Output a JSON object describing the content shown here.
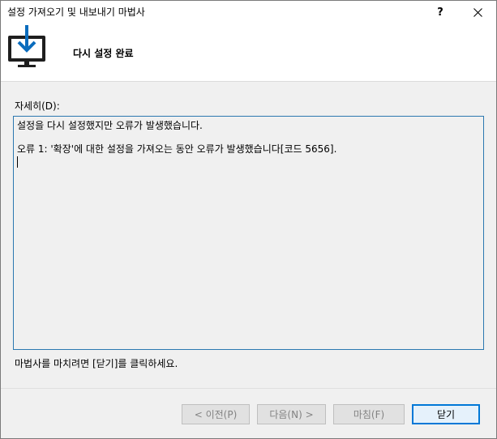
{
  "window": {
    "title": "설정 가져오기 및 내보내기 마법사",
    "help_label": "?",
    "close_label": "✕"
  },
  "header": {
    "title": "다시 설정 완료",
    "icon": "monitor-download-icon"
  },
  "details": {
    "label": "자세히(D):",
    "lines": [
      "설정을 다시 설정했지만 오류가 발생했습니다.",
      "오류 1:  '확장'에 대한 설정을 가져오는 동안 오류가 발생했습니다[코드 5656]."
    ]
  },
  "hint": "마법사를 마치려면 [닫기]를 클릭하세요.",
  "buttons": {
    "prev": "< 이전(P)",
    "next": "다음(N) >",
    "finish": "마침(F)",
    "close": "닫기"
  },
  "colors": {
    "accent": "#0078d7",
    "icon_blue": "#0a6cbd"
  }
}
